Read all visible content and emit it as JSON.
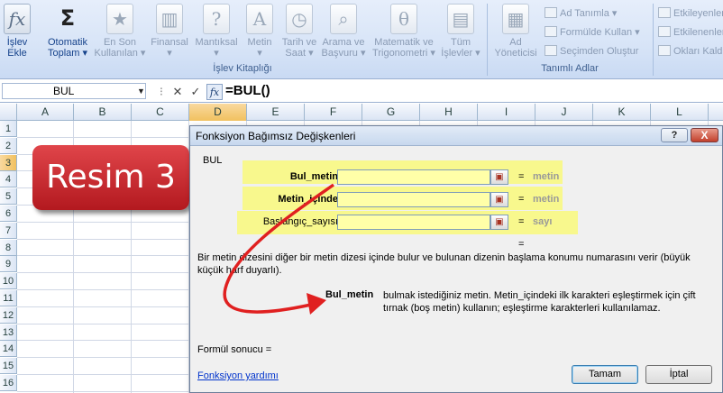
{
  "ribbon": {
    "buttons": [
      {
        "icon": "fx-icon",
        "label_1": "İşlev",
        "label_2": "Ekle"
      },
      {
        "icon": "sigma-icon",
        "label_1": "Otomatik",
        "label_2": "Toplam ▾"
      },
      {
        "icon": "star-book-icon",
        "label_1": "En Son",
        "label_2": "Kullanılan ▾"
      },
      {
        "icon": "book-icon",
        "label_1": "Finansal",
        "label_2": "▾"
      },
      {
        "icon": "question-book-icon",
        "label_1": "Mantıksal",
        "label_2": "▾"
      },
      {
        "icon": "a-book-icon",
        "label_1": "Metin",
        "label_2": "▾"
      },
      {
        "icon": "clock-book-icon",
        "label_1": "Tarih ve",
        "label_2": "Saat ▾"
      },
      {
        "icon": "search-book-icon",
        "label_1": "Arama ve",
        "label_2": "Başvuru ▾"
      },
      {
        "icon": "theta-book-icon",
        "label_1": "Matematik ve",
        "label_2": "Trigonometri ▾"
      },
      {
        "icon": "books-icon",
        "label_1": "Tüm",
        "label_2": "İşlevler ▾"
      },
      {
        "icon": "name-manager-icon",
        "label_1": "Ad",
        "label_2": "Yöneticisi"
      }
    ],
    "group_islev": "İşlev Kitaplığı",
    "group_adlar": "Tanımlı Adlar",
    "define_name": "Ad Tanımla ▾",
    "use_in_formula": "Formülde Kullan ▾",
    "create_from_selection": "Seçimden Oluştur",
    "trace_precedents": "Etkileyenleri",
    "trace_dependents": "Etkilenenleri",
    "remove_arrows": "Okları Kaldır"
  },
  "formula_bar": {
    "name_box": "BUL",
    "formula": "=BUL()"
  },
  "sheet": {
    "columns": [
      "A",
      "B",
      "C",
      "D",
      "E",
      "F",
      "G",
      "H",
      "I",
      "J",
      "K",
      "L"
    ],
    "rows": [
      "1",
      "2",
      "3",
      "4",
      "5",
      "6",
      "7",
      "8",
      "9",
      "10",
      "11",
      "12",
      "13",
      "14",
      "15",
      "16"
    ],
    "selected_col": "D",
    "selected_row": "3"
  },
  "overlay": {
    "label": "Resim 3"
  },
  "dialog": {
    "title": "Fonksiyon Bağımsız Değişkenleri",
    "help_btn": "?",
    "close_btn": "X",
    "function_name": "BUL",
    "args": [
      {
        "label": "Bul_metin",
        "hint": "metin",
        "bold": true
      },
      {
        "label": "Metin_içinde",
        "hint": "metin",
        "bold": true
      },
      {
        "label": "Başlangıç_sayısı",
        "hint": "sayı",
        "bold": false
      }
    ],
    "eq": "=",
    "description": "Bir metin dizesini diğer bir metin dizesi içinde bulur ve bulunan dizenin başlama konumu numarasını verir (büyük küçük harf duyarlı).",
    "arg_desc_name": "Bul_metin",
    "arg_desc": "bulmak istediğiniz metin. Metin_içindeki ilk karakteri eşleştirmek için çift tırnak (boş metin) kullanın; eşleştirme karakterleri kullanılamaz.",
    "formula_result": "Formül sonucu =",
    "help_link": "Fonksiyon yardımı",
    "ok": "Tamam",
    "cancel": "İptal"
  },
  "colors": {
    "ribbon_bg": "#d7e4f7",
    "highlight": "#ffff3c",
    "arrow": "#e02020",
    "label_red": "#c62828"
  }
}
